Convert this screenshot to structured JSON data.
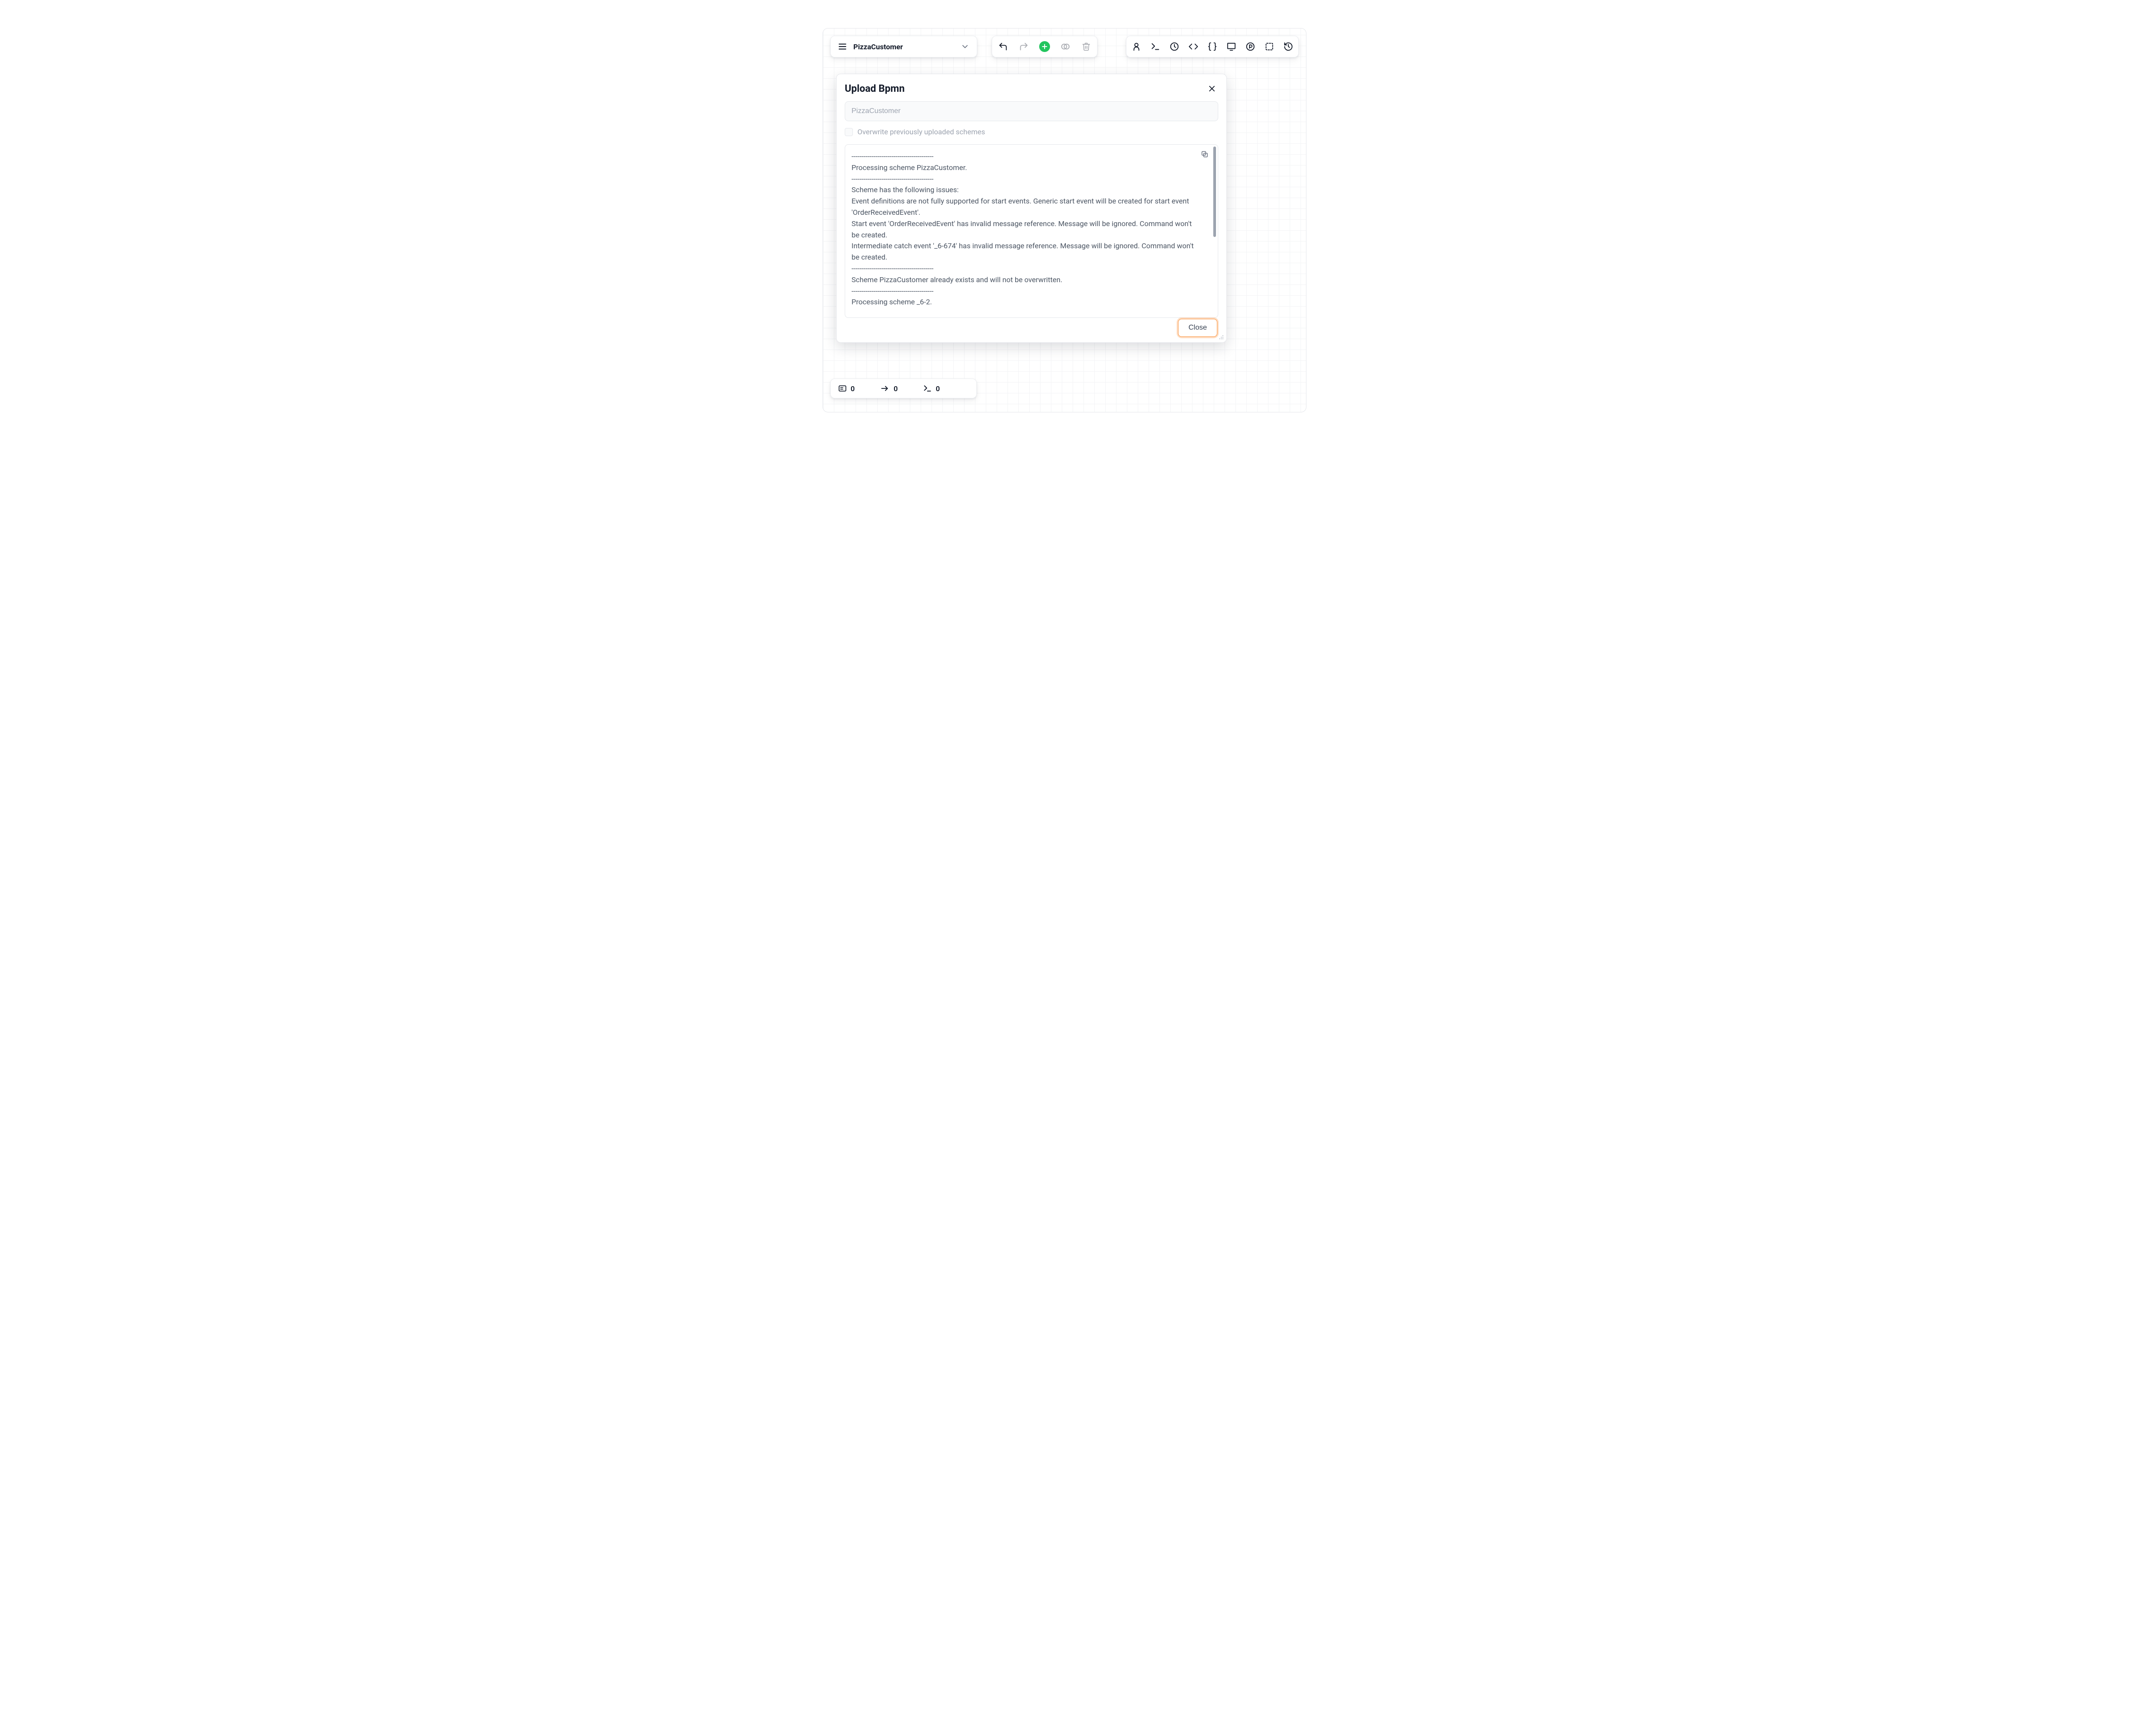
{
  "header": {
    "scheme_name": "PizzaCustomer"
  },
  "modal": {
    "title": "Upload Bpmn",
    "input_value": "PizzaCustomer",
    "overwrite_label": "Overwrite previously uploaded schemes",
    "overwrite_checked": false,
    "close_label": "Close",
    "log_text": "-----------------------------------------\nProcessing scheme PizzaCustomer.\n-----------------------------------------\nScheme has the following issues:\nEvent definitions are not fully supported for start events. Generic start event will be created for start event 'OrderReceivedEvent'.\nStart event 'OrderReceivedEvent' has invalid message reference. Message will be ignored. Command won't be created.\nIntermediate catch event '_6-674' has invalid message reference. Message will be ignored. Command won't be created.\n-----------------------------------------\nScheme PizzaCustomer already exists and will not be overwritten.\n-----------------------------------------\nProcessing scheme _6-2."
  },
  "status": {
    "forms": "0",
    "transitions": "0",
    "commands": "0"
  }
}
